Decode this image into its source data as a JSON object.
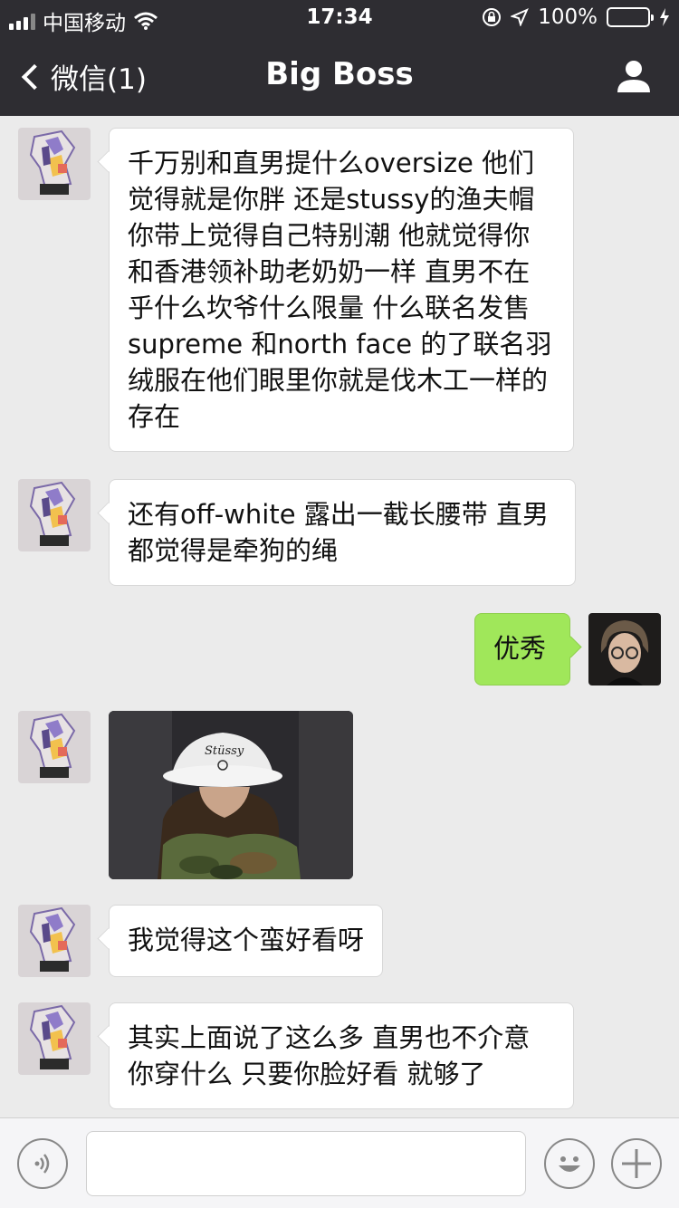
{
  "status_bar": {
    "carrier": "中国移动",
    "time": "17:34",
    "battery": "100%",
    "battery_level": 1.0
  },
  "nav": {
    "back_label": "微信(1)",
    "title": "Big Boss"
  },
  "messages": [
    {
      "side": "left",
      "type": "text",
      "text": "千万别和直男提什么oversize 他们觉得就是你胖 还是stussy的渔夫帽 你带上觉得自己特别潮 他就觉得你和香港领补助老奶奶一样 直男不在乎什么坎爷什么限量 什么联名发售 supreme 和north face 的了联名羽绒服在他们眼里你就是伐木工一样的存在"
    },
    {
      "side": "left",
      "type": "text",
      "text": "还有off-white 露出一截长腰带 直男都觉得是牵狗的绳"
    },
    {
      "side": "right",
      "type": "text",
      "text": "优秀"
    },
    {
      "side": "left",
      "type": "image",
      "hat_text": "Stüssy"
    },
    {
      "side": "left",
      "type": "text",
      "text": "我觉得这个蛮好看呀"
    },
    {
      "side": "left",
      "type": "text",
      "text": "其实上面说了这么多 直男也不介意你穿什么 只要你脸好看 就够了"
    }
  ],
  "input": {
    "placeholder": "",
    "value": ""
  },
  "colors": {
    "nav_bg": "#2e2d32",
    "chat_bg": "#ebebeb",
    "bubble_self": "#a0e75a",
    "bubble_other": "#ffffff",
    "battery": "#4cd964"
  },
  "icons": {
    "voice": "voice-icon",
    "emoji": "emoji-icon",
    "plus": "plus-icon",
    "user": "user-icon",
    "back": "chevron-left-icon"
  }
}
